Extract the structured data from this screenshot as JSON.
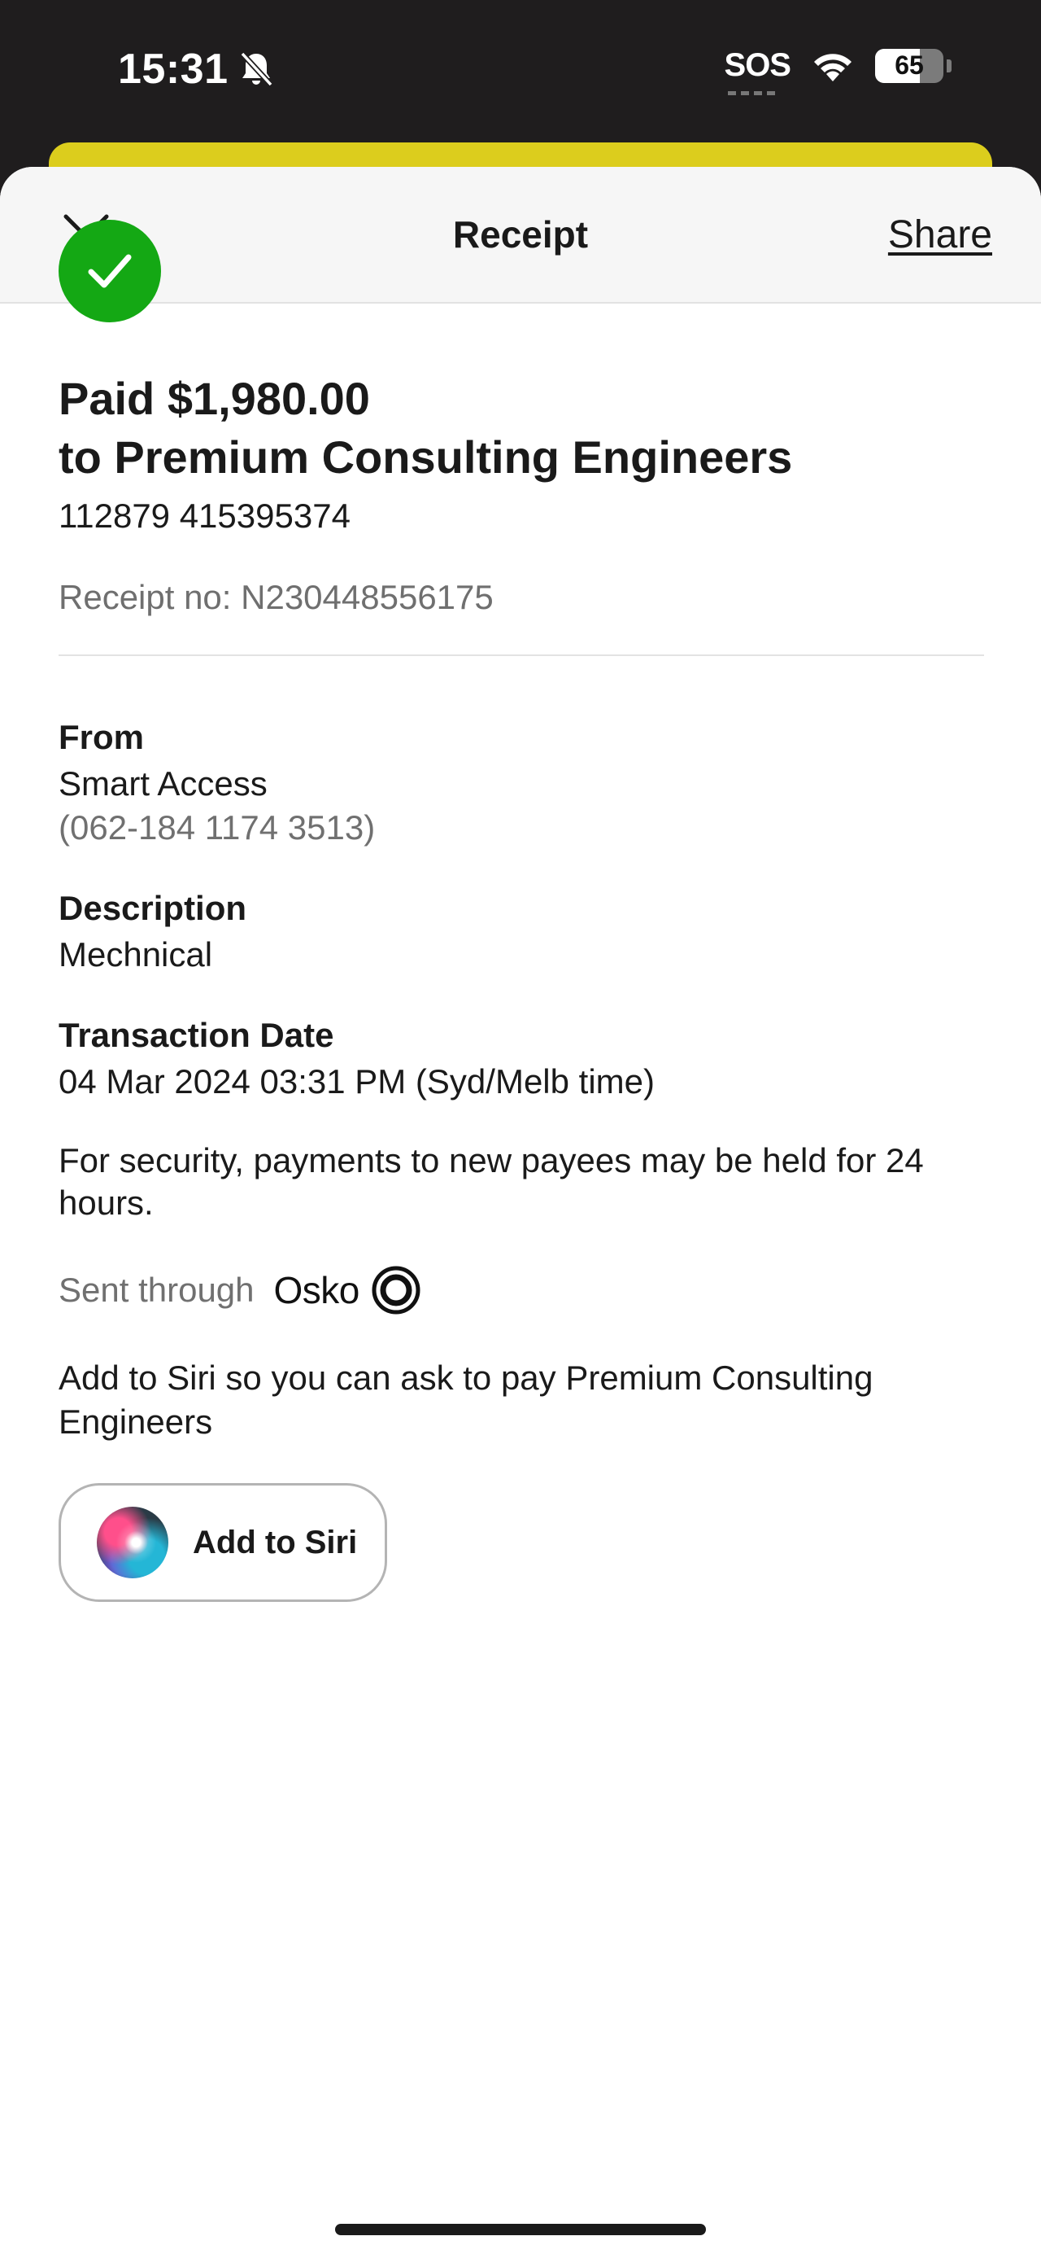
{
  "status_bar": {
    "time": "15:31",
    "carrier": "SOS",
    "battery_level": "65",
    "battery_fraction": 0.65
  },
  "header": {
    "title": "Receipt",
    "share_label": "Share"
  },
  "receipt": {
    "paid_line": "Paid $1,980.00",
    "payee_line": "to Premium Consulting Engineers",
    "payee_account": "112879 415395374",
    "receipt_number": "Receipt no: N230448556175"
  },
  "from": {
    "label": "From",
    "account_name": "Smart Access",
    "account_number": "(062-184 1174 3513)"
  },
  "description": {
    "label": "Description",
    "value": "Mechnical"
  },
  "transaction_date": {
    "label": "Transaction Date",
    "value": "04 Mar 2024 03:31 PM (Syd/Melb time)"
  },
  "security_note": "For security, payments to new payees may be held for 24 hours.",
  "sent_through": {
    "label": "Sent through",
    "brand": "Osko"
  },
  "siri": {
    "prompt": "Add to Siri so you can ask to pay Premium Consulting Engineers",
    "button_label": "Add to Siri"
  },
  "colors": {
    "success_green": "#14a814",
    "brand_yellow": "#dccd1d",
    "status_bar_bg": "#1f1d1e"
  }
}
